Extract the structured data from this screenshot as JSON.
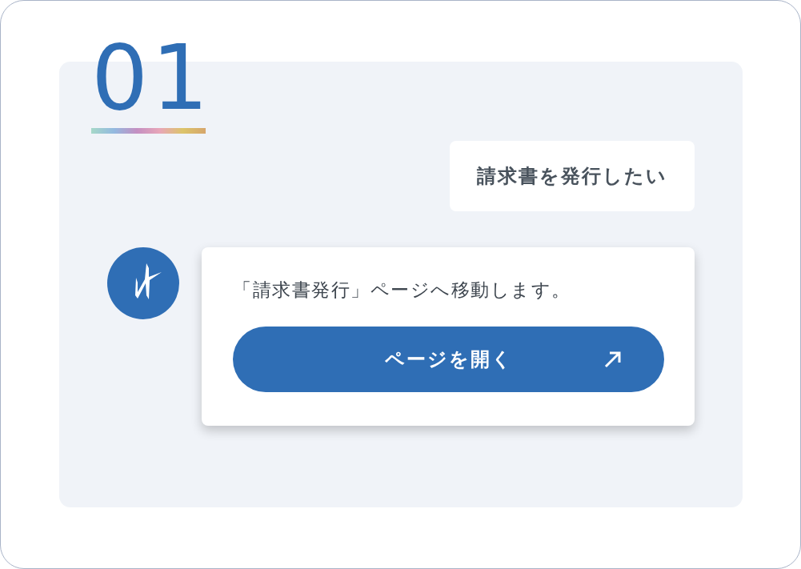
{
  "step_number": "01",
  "user_message": "請求書を発行したい",
  "bot_reply": {
    "text": "「請求書発行」ページへ移動します。",
    "button": "ページを開く"
  }
}
